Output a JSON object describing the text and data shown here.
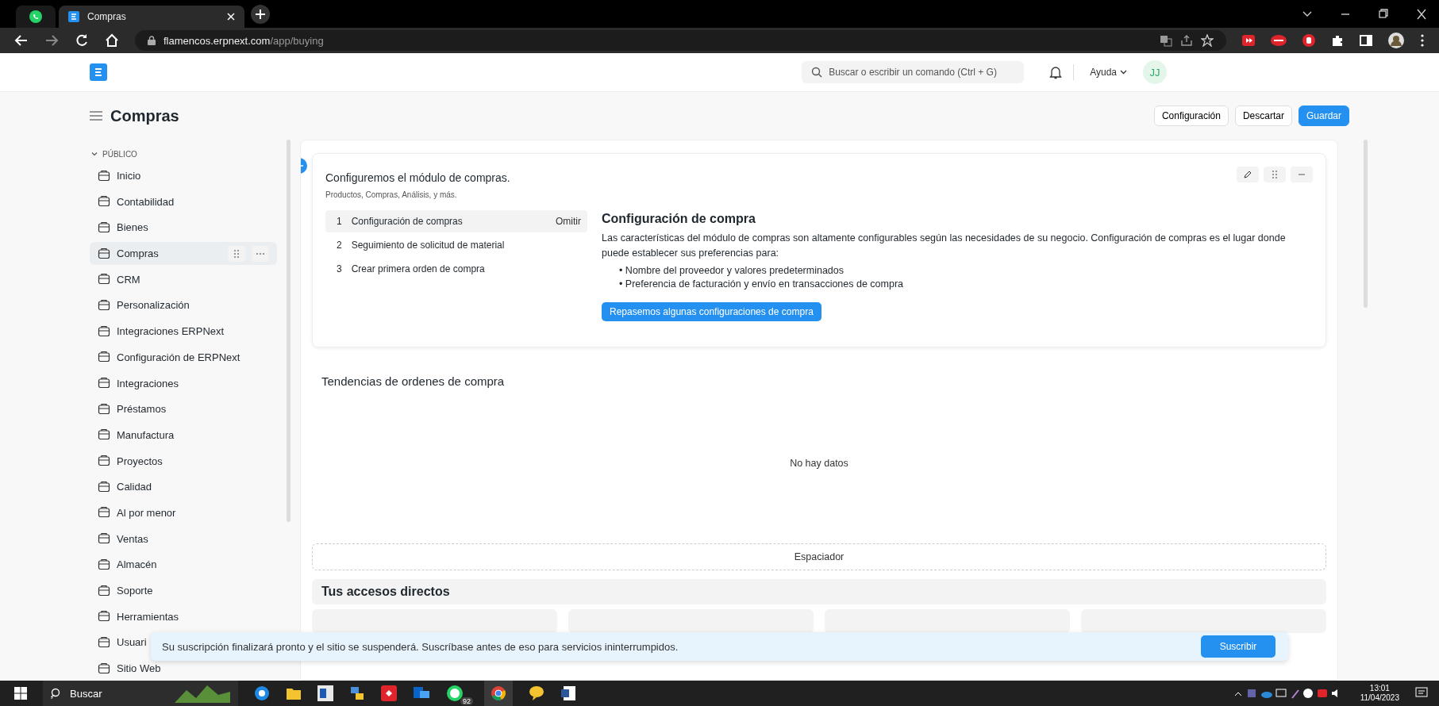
{
  "browser": {
    "tabs": [
      {
        "kind": "pinned",
        "selected": false
      },
      {
        "kind": "page",
        "title": "Compras",
        "selected": true
      }
    ],
    "url_host": "flamencos.erpnext.com",
    "url_path": "/app/buying"
  },
  "navbar": {
    "search": {
      "placeholder": "Buscar o escribir un comando (Ctrl + G)"
    },
    "help": "Ayuda",
    "avatar": "JJ"
  },
  "page": {
    "title": "Compras",
    "buttons": [
      {
        "label": "Configuración",
        "kind": "default"
      },
      {
        "label": "Descartar",
        "kind": "default"
      },
      {
        "label": "Guardar",
        "kind": "primary"
      }
    ]
  },
  "sidebar": {
    "section": "PÚBLICO",
    "expanded": true,
    "items": [
      {
        "label": "Inicio",
        "selected": false
      },
      {
        "label": "Contabilidad",
        "selected": false
      },
      {
        "label": "Bienes",
        "selected": false
      },
      {
        "label": "Compras",
        "selected": true
      },
      {
        "label": "CRM",
        "selected": false
      },
      {
        "label": "Personalización",
        "selected": false
      },
      {
        "label": "Integraciones ERPNext",
        "selected": false
      },
      {
        "label": "Configuración de ERPNext",
        "selected": false
      },
      {
        "label": "Integraciones",
        "selected": false
      },
      {
        "label": "Préstamos",
        "selected": false
      },
      {
        "label": "Manufactura",
        "selected": false
      },
      {
        "label": "Proyectos",
        "selected": false
      },
      {
        "label": "Calidad",
        "selected": false
      },
      {
        "label": "Al por menor",
        "selected": false
      },
      {
        "label": "Ventas",
        "selected": false
      },
      {
        "label": "Almacén",
        "selected": false
      },
      {
        "label": "Soporte",
        "selected": false
      },
      {
        "label": "Herramientas",
        "selected": false
      },
      {
        "label": "Usuari",
        "selected": false
      },
      {
        "label": "Sitio Web",
        "selected": false
      }
    ]
  },
  "onboarding": {
    "title": "Configuremos el módulo de compras.",
    "subtitle": "Productos, Compras, Análisis, y más.",
    "steps": [
      {
        "number": "1",
        "label": "Configuración de compras",
        "selected": true,
        "action": "Omitir"
      },
      {
        "number": "2",
        "label": "Seguimiento de solicitud de material",
        "selected": false
      },
      {
        "number": "3",
        "label": "Crear primera orden de compra",
        "selected": false
      }
    ],
    "detail": {
      "title": "Configuración de compra",
      "text": "Las características del módulo de compras son altamente configurables según las necesidades de su negocio. Configuración de compras es el lugar donde puede establecer sus preferencias para:",
      "bullets": [
        {
          "marker": "•",
          "text": "Nombre del proveedor y valores predeterminados"
        },
        {
          "marker": "•",
          "text": "Preferencia de facturación y envío en transacciones de compra"
        }
      ],
      "button": "Repasemos algunas configuraciones de compra"
    }
  },
  "chart": {
    "title": "Tendencias de ordenes de compra",
    "empty_text": "No hay datos"
  },
  "spacer": "Espaciador",
  "shortcuts": {
    "title": "Tus accesos directos"
  },
  "banner": {
    "text": "Su suscripción finalizará pronto y el sitio se suspenderá. Suscríbase antes de eso para servicios ininterrumpidos.",
    "button": "Suscribir"
  },
  "taskbar": {
    "search": "Buscar",
    "badge": "92",
    "time": "13:01",
    "date": "11/04/2023"
  }
}
